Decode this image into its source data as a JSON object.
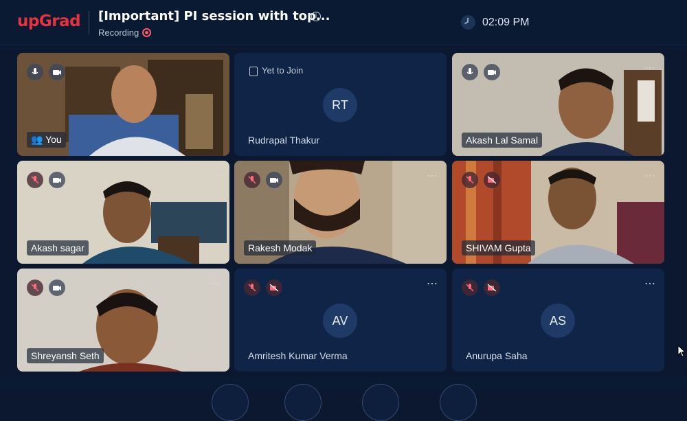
{
  "header": {
    "logo": "upGrad",
    "title": "[Important] PI session with top...",
    "recording_label": "Recording",
    "time": "02:09 PM",
    "info_icon": "info-icon",
    "clock_icon": "clock-icon"
  },
  "participants": [
    {
      "name": "You",
      "type": "video",
      "mic": "on",
      "cam": "on",
      "self": true,
      "bg": "#7a6244"
    },
    {
      "name": "Rudrapal Thakur",
      "type": "avatar",
      "initials": "RT",
      "status": "Yet to Join"
    },
    {
      "name": "Akash Lal Samal",
      "type": "video",
      "mic": "on",
      "cam": "on",
      "bg": "#c9c3b8"
    },
    {
      "name": "Akash sagar",
      "type": "video",
      "mic": "off",
      "cam": "on",
      "bg": "#d9d5c8"
    },
    {
      "name": "Rakesh Modak",
      "type": "video",
      "mic": "off",
      "cam": "on",
      "bg": "#b9a78e"
    },
    {
      "name": "SHIVAM Gupta",
      "type": "video",
      "mic": "off",
      "cam": "off",
      "bg": "#c9bba7"
    },
    {
      "name": "Shreyansh Seth",
      "type": "video",
      "mic": "off",
      "cam": "on",
      "bg": "#d6d1c8"
    },
    {
      "name": "Amritesh Kumar Verma",
      "type": "avatar",
      "initials": "AV",
      "mic": "off",
      "cam": "off"
    },
    {
      "name": "Anurupa Saha",
      "type": "avatar",
      "initials": "AS",
      "mic": "off",
      "cam": "off"
    }
  ],
  "colors": {
    "background": "#0b1830",
    "tile_dark": "#0f2446",
    "brand_red": "#e8323f",
    "recording_red": "#ff5a68"
  }
}
